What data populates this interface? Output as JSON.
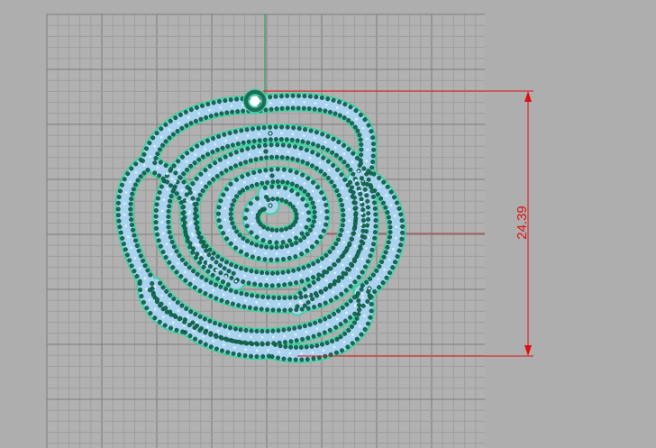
{
  "viewport": {
    "name": "Top",
    "background": "#aeaeae",
    "grid_minor_color": "#9e9e9e",
    "grid_major_color": "#7c7c7c",
    "axis_y_color": "#1e9a3a",
    "axis_x_color": "#b44444"
  },
  "model": {
    "object": "rose-pendant",
    "stone_color": "#a9d3ef",
    "prong_color": "#136b52",
    "outline_color": "#3fd3a3",
    "bail_color": "#1c6e56"
  },
  "dimension": {
    "value": "24.39",
    "color": "#e01010"
  }
}
